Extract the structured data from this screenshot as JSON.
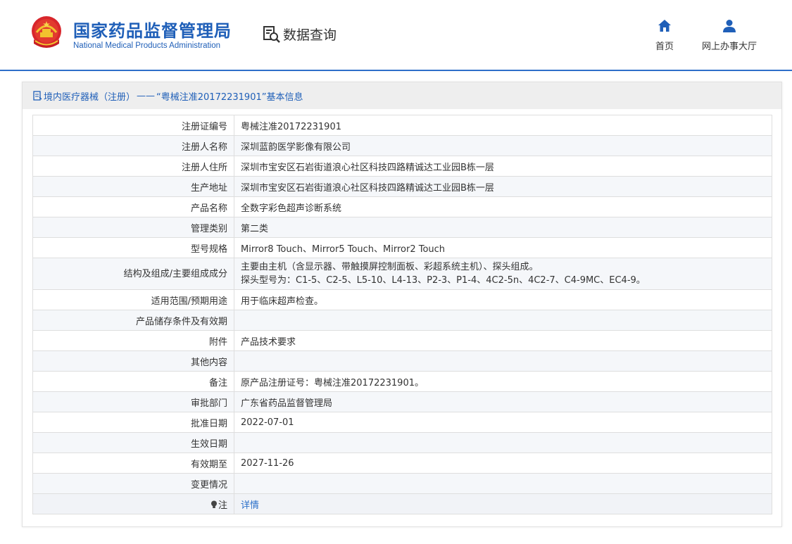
{
  "header": {
    "org_name_cn": "国家药品监督管理局",
    "org_name_en": "National Medical Products Administration",
    "data_query_label": "数据查询",
    "nav": [
      {
        "label": "首页",
        "icon": "home-icon"
      },
      {
        "label": "网上办事大厅",
        "icon": "user-icon"
      }
    ],
    "accent_color": "#1f5fb8"
  },
  "panel": {
    "breadcrumb": {
      "category_link": "境内医疗器械（注册）",
      "separator": "——",
      "title": "“粤械注准20172231901”基本信息"
    }
  },
  "record": {
    "rows": [
      {
        "key": "注册证编号",
        "value": "粤械注准20172231901"
      },
      {
        "key": "注册人名称",
        "value": "深圳蓝韵医学影像有限公司"
      },
      {
        "key": "注册人住所",
        "value": "深圳市宝安区石岩街道浪心社区科技四路精诚达工业园B栋一层"
      },
      {
        "key": "生产地址",
        "value": "深圳市宝安区石岩街道浪心社区科技四路精诚达工业园B栋一层"
      },
      {
        "key": "产品名称",
        "value": "全数字彩色超声诊断系统"
      },
      {
        "key": "管理类别",
        "value": "第二类"
      },
      {
        "key": "型号规格",
        "value": "Mirror8 Touch、Mirror5 Touch、Mirror2 Touch"
      },
      {
        "key": "结构及组成/主要组成成分",
        "value_line1": "主要由主机（含显示器、带触摸屏控制面板、彩超系统主机）、探头组成。",
        "value_line2": "探头型号为：C1-5、C2-5、L5-10、L4-13、P2-3、P1-4、4C2-5n、4C2-7、C4-9MC、EC4-9。"
      },
      {
        "key": "适用范围/预期用途",
        "value": "用于临床超声检查。"
      },
      {
        "key": "产品储存条件及有效期",
        "value": ""
      },
      {
        "key": "附件",
        "value": "产品技术要求"
      },
      {
        "key": "其他内容",
        "value": ""
      },
      {
        "key": "备注",
        "value": "原产品注册证号：粤械注准20172231901。"
      },
      {
        "key": "审批部门",
        "value": "广东省药品监督管理局"
      },
      {
        "key": "批准日期",
        "value": "2022-07-01"
      },
      {
        "key": "生效日期",
        "value": ""
      },
      {
        "key": "有效期至",
        "value": "2027-11-26"
      },
      {
        "key": "变更情况",
        "value": ""
      },
      {
        "key": "注",
        "value": "详情"
      }
    ]
  }
}
